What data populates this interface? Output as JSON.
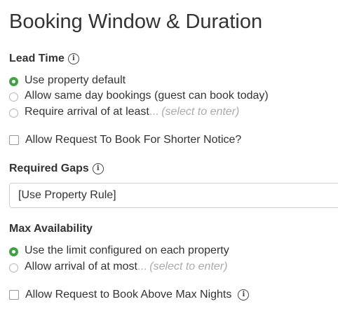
{
  "page": {
    "title": "Booking Window & Duration"
  },
  "lead_time": {
    "heading": "Lead Time",
    "options": [
      {
        "label": "Use property default",
        "checked": true
      },
      {
        "label": "Allow same day bookings (guest can book today)",
        "checked": false
      },
      {
        "label": "Require arrival of at least",
        "suffix": "...",
        "hint": "(select to enter)",
        "checked": false
      }
    ],
    "request_shorter_notice": {
      "label": "Allow Request To Book For Shorter Notice?",
      "checked": false
    }
  },
  "required_gaps": {
    "heading": "Required Gaps",
    "selected_value": "[Use Property Rule]"
  },
  "max_availability": {
    "heading": "Max Availability",
    "options": [
      {
        "label": "Use the limit configured on each property",
        "checked": true
      },
      {
        "label": "Allow arrival of at most",
        "suffix": "...",
        "hint": "(select to enter)",
        "checked": false
      }
    ],
    "request_above_max": {
      "label": "Allow Request to Book Above Max Nights",
      "checked": false
    }
  },
  "icons": {
    "info": "i"
  },
  "colors": {
    "radio_checked": "#43a047",
    "text": "#333333",
    "hint": "#aaaaaa"
  }
}
